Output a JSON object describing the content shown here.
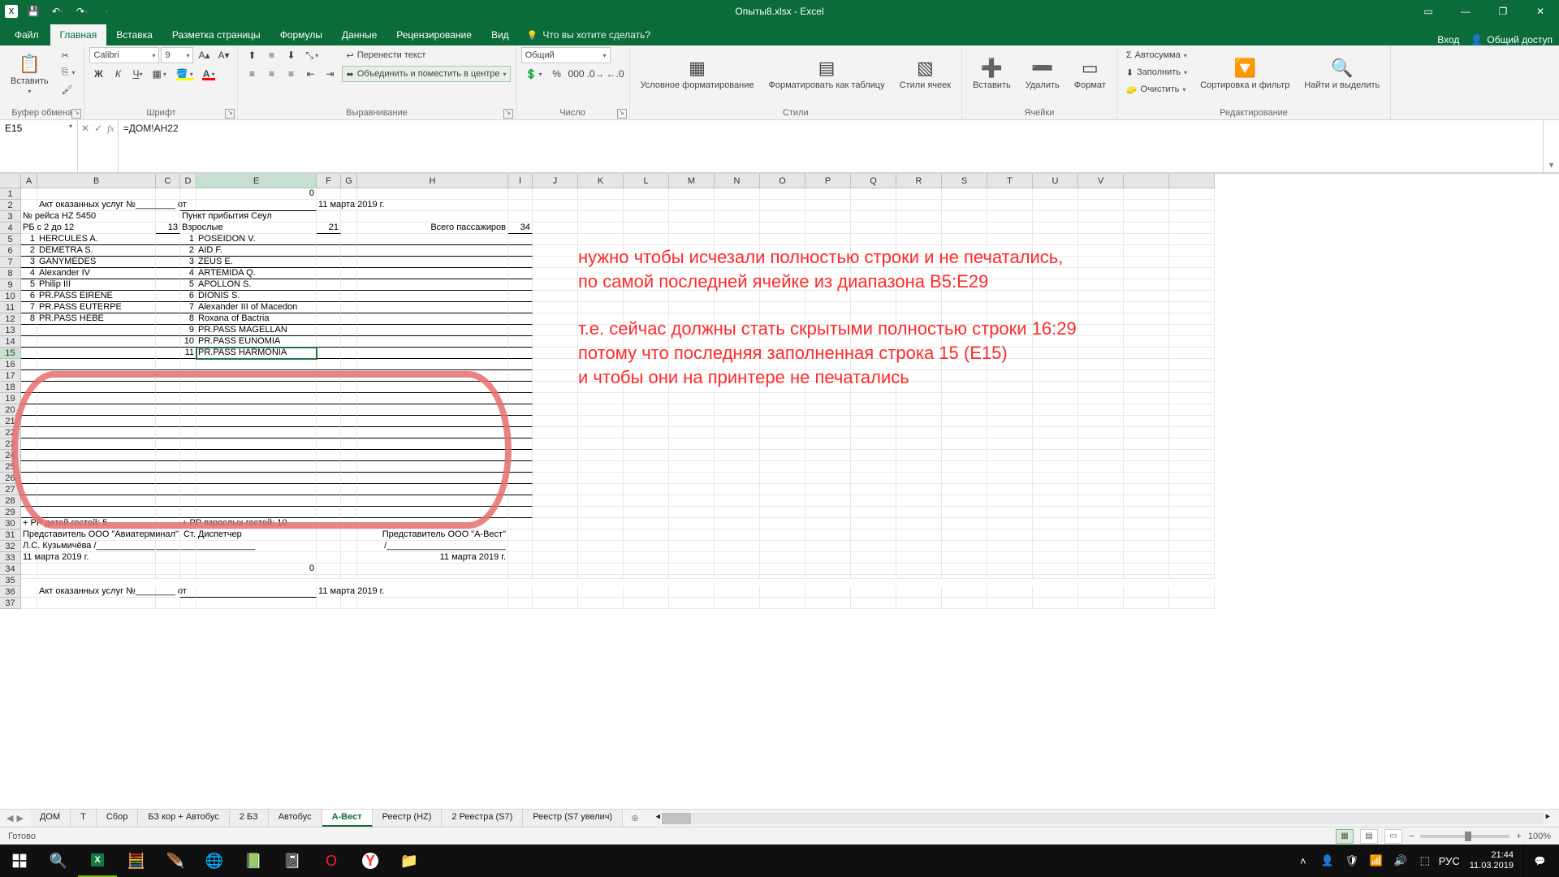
{
  "title": "Опыты8.xlsx - Excel",
  "qat": {
    "save": "💾",
    "undo": "↶",
    "redo": "↷"
  },
  "tabs": {
    "file": "Файл",
    "list": [
      "Главная",
      "Вставка",
      "Разметка страницы",
      "Формулы",
      "Данные",
      "Рецензирование",
      "Вид"
    ],
    "active": 0,
    "tellme": "Что вы хотите сделать?",
    "signin": "Вход",
    "share": "Общий доступ"
  },
  "ribbon": {
    "clipboard": {
      "paste": "Вставить",
      "cut": "Вырезать",
      "copy": "Копировать",
      "painter": "Формат по образцу",
      "label": "Буфер обмена"
    },
    "font": {
      "name": "Calibri",
      "size": "9",
      "label": "Шрифт"
    },
    "align": {
      "wrap": "Перенести текст",
      "merge": "Объединить и поместить в центре",
      "label": "Выравнивание"
    },
    "number": {
      "fmt": "Общий",
      "label": "Число"
    },
    "styles": {
      "cond": "Условное форматирование",
      "table": "Форматировать как таблицу",
      "cell": "Стили ячеек",
      "label": "Стили"
    },
    "cells": {
      "insert": "Вставить",
      "delete": "Удалить",
      "format": "Формат",
      "label": "Ячейки"
    },
    "editing": {
      "sum": "Автосумма",
      "fill": "Заполнить",
      "clear": "Очистить",
      "sort": "Сортировка и фильтр",
      "find": "Найти и выделить",
      "label": "Редактирование"
    }
  },
  "namebox": "E15",
  "formula": "=ДОМ!AH22",
  "cols": [
    "A",
    "B",
    "C",
    "D",
    "E",
    "F",
    "G",
    "H",
    "I",
    "J",
    "K",
    "L",
    "M",
    "N",
    "O",
    "P",
    "Q",
    "R",
    "S",
    "T",
    "U",
    "V"
  ],
  "rows": {
    "r1": {
      "E": "0"
    },
    "r2": {
      "B": "Акт оказанных услуг №________ от",
      "F": "11 марта 2019 г."
    },
    "r3": {
      "A": "№ рейса HZ 5450",
      "D": "Пункт прибытия Сеул"
    },
    "r4": {
      "A": "РБ с 2 до 12",
      "C": "13",
      "D": "Взрослые",
      "F": "21",
      "H": "Всего пассажиров",
      "I": "34"
    },
    "list1": [
      {
        "n": "1",
        "name": "HERCULES A."
      },
      {
        "n": "2",
        "name": "DEMETRA S."
      },
      {
        "n": "3",
        "name": "GANYMEDES"
      },
      {
        "n": "4",
        "name": "Alexander IV"
      },
      {
        "n": "5",
        "name": "Philip III"
      },
      {
        "n": "6",
        "name": "PR.PASS EIRENE"
      },
      {
        "n": "7",
        "name": "PR.PASS EUTERPE"
      },
      {
        "n": "8",
        "name": "PR.PASS HEBE"
      }
    ],
    "list2": [
      {
        "n": "1",
        "name": "POSEIDON V."
      },
      {
        "n": "2",
        "name": "AID F."
      },
      {
        "n": "3",
        "name": "ZEUS E."
      },
      {
        "n": "4",
        "name": "ARTEMIDA Q."
      },
      {
        "n": "5",
        "name": "APOLLON S."
      },
      {
        "n": "6",
        "name": "DIONIS S."
      },
      {
        "n": "7",
        "name": "Alexander III of Macedon"
      },
      {
        "n": "8",
        "name": "Roxana of Bactria"
      },
      {
        "n": "9",
        "name": "PR.PASS MAGELLAN"
      },
      {
        "n": "10",
        "name": "PR.PASS EUNOMIA"
      },
      {
        "n": "11",
        "name": "PR.PASS HARMONIA"
      }
    ],
    "r30": {
      "A": "+  РР детей гостей: 5",
      "D": "+  РР взрослых гостей: 10"
    },
    "r31": {
      "A": "Представитель ООО \"Авиатерминал\", Ст. Диспетчер",
      "H": "Представитель ООО \"А-Вест\""
    },
    "r32": {
      "A": "Л.С. Кузьмичёва /________________________________",
      "H": "/________________________"
    },
    "r33": {
      "A": "11 марта 2019 г.",
      "H": "11 марта 2019 г."
    },
    "r34": {
      "E": "0"
    },
    "r36": {
      "B": "Акт оказанных услуг №________ от",
      "F": "11 марта 2019 г."
    }
  },
  "annotation": {
    "l1": "нужно чтобы исчезали полностью строки и не печатались,",
    "l2": "по самой последней ячейке из диапазона B5:E29",
    "l3": "т.е. сейчас должны стать скрытыми полностью строки 16:29",
    "l4": "потому что последняя заполненная строка 15 (E15)",
    "l5": "и чтобы они на принтере не печатались"
  },
  "sheets": [
    "ДОМ",
    "Т",
    "Сбор",
    "БЗ кор + Автобус",
    "2 БЗ",
    "Автобус",
    "А-Вест",
    "Реестр (HZ)",
    "2 Реестра (S7)",
    "Реестр (S7 увелич)"
  ],
  "active_sheet": 6,
  "status": {
    "ready": "Готово",
    "zoom": "100%"
  },
  "taskbar": {
    "lang": "РУС",
    "time": "21:44",
    "date": "11.03.2019"
  }
}
